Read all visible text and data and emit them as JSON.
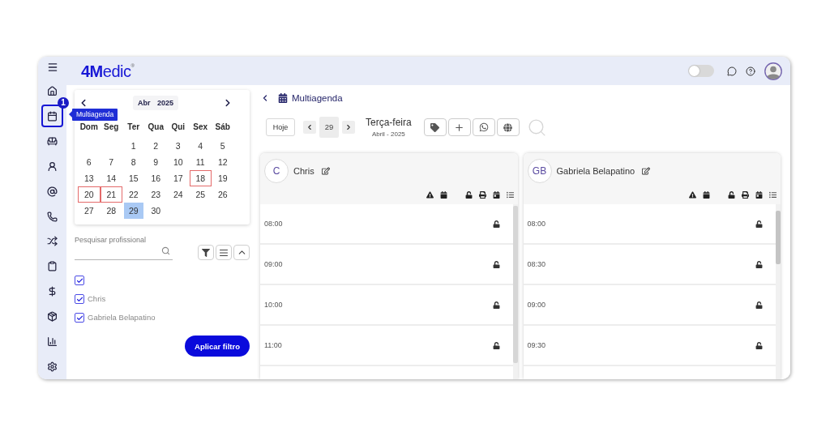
{
  "topbar": {
    "logo": "**4M**edic$^{®}$",
    "toggle": {
      "on": false
    }
  },
  "sidebar": {
    "items": [
      {
        "selected": false
      },
      {
        "selected": true,
        "badge": "1",
        "tooltip": "Multiagenda"
      },
      {
        "selected": false
      },
      {
        "selected": false
      },
      {
        "selected": false
      },
      {
        "selected": false
      },
      {
        "selected": false
      },
      {
        "selected": false
      },
      {
        "selected": false
      },
      {
        "selected": false
      },
      {
        "selected": false
      },
      {
        "selected": false
      }
    ]
  },
  "calendar": {
    "month": "Abr",
    "year": "2025",
    "weekdays": [
      "Dom",
      "Seg",
      "Ter",
      "Qua",
      "Qui",
      "Sex",
      "Sáb"
    ],
    "weeks": [
      [
        {
          "day": "1",
          "selected": false,
          "marked": false
        },
        {
          "day": "2",
          "selected": false,
          "marked": false
        },
        {
          "day": "3",
          "selected": false,
          "marked": false
        },
        {
          "day": "4",
          "selected": false,
          "marked": false
        },
        {
          "day": "5",
          "selected": false,
          "marked": false
        }
      ],
      [
        {
          "day": "6",
          "selected": false,
          "marked": false
        },
        {
          "day": "7",
          "selected": false,
          "marked": false
        },
        {
          "day": "8",
          "selected": false,
          "marked": false
        },
        {
          "day": "9",
          "selected": false,
          "marked": false
        },
        {
          "day": "10",
          "selected": false,
          "marked": false
        },
        {
          "day": "11",
          "selected": false,
          "marked": false
        },
        {
          "day": "12",
          "selected": false,
          "marked": false
        }
      ],
      [
        {
          "day": "13",
          "selected": false,
          "marked": false
        },
        {
          "day": "14",
          "selected": false,
          "marked": false
        },
        {
          "day": "15",
          "selected": false,
          "marked": false
        },
        {
          "day": "16",
          "selected": false,
          "marked": false
        },
        {
          "day": "17",
          "selected": false,
          "marked": false
        },
        {
          "day": "18",
          "selected": false,
          "marked": true
        },
        {
          "day": "19",
          "selected": false,
          "marked": false
        }
      ],
      [
        {
          "day": "20",
          "selected": false,
          "marked": true
        },
        {
          "day": "21",
          "selected": false,
          "marked": true
        },
        {
          "day": "22",
          "selected": false,
          "marked": false
        },
        {
          "day": "23",
          "selected": false,
          "marked": false
        },
        {
          "day": "24",
          "selected": false,
          "marked": false
        },
        {
          "day": "25",
          "selected": false,
          "marked": false
        },
        {
          "day": "26",
          "selected": false,
          "marked": false
        }
      ],
      [
        {
          "day": "27",
          "selected": false,
          "marked": false
        },
        {
          "day": "28",
          "selected": false,
          "marked": false
        },
        {
          "day": "29",
          "selected": true,
          "marked": false
        },
        {
          "day": "30",
          "selected": false,
          "marked": false
        }
      ]
    ]
  },
  "filter": {
    "search": {
      "label": "Pesquisar profissional"
    },
    "options": [
      {
        "checked": true
      },
      {
        "label": "Chris",
        "checked": true
      },
      {
        "label": "Gabriela Belapatino",
        "checked": true
      }
    ],
    "apply_button": "Aplicar filtro"
  },
  "schedule": {
    "title": "Multiagenda",
    "today_button": "Hoje",
    "day": "29",
    "weekday": "Terça-feira",
    "month_year": "Abril - 2025",
    "professionals": [
      {
        "initials": "C",
        "name": "Chris",
        "slots": [
          {
            "time": "08:00",
            "locked": false
          },
          {
            "time": "09:00",
            "locked": false
          },
          {
            "time": "10:00",
            "locked": false
          },
          {
            "time": "11:00",
            "locked": false
          }
        ]
      },
      {
        "initials": "GB",
        "name": "Gabriela Belapatino",
        "slots": [
          {
            "time": "08:00",
            "locked": false
          },
          {
            "time": "08:30",
            "locked": false
          },
          {
            "time": "09:00",
            "locked": false
          },
          {
            "time": "09:30",
            "locked": false
          }
        ]
      }
    ]
  }
}
